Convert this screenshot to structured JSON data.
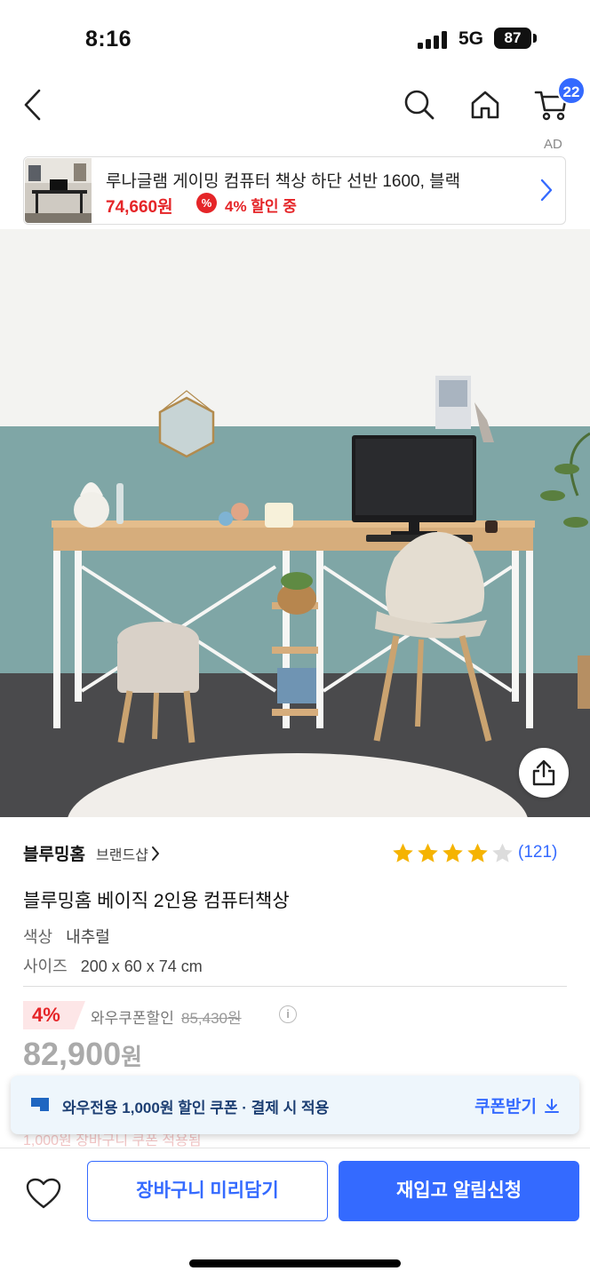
{
  "status_bar": {
    "time": "8:16",
    "network": "5G",
    "battery": "87"
  },
  "nav": {
    "cart_count": "22",
    "ad_label": "AD"
  },
  "ad": {
    "title": "루나글램 게이밍 컴퓨터 책상 하단 선반 1600, 블랙",
    "price": "74,660원",
    "coupon_icon": "%",
    "discount": "4% 할인 중"
  },
  "product": {
    "brand": "블루밍홈",
    "brand_shop": "브랜드샵",
    "rating": 4,
    "review_count": "(121)",
    "title": "블루밍홈 베이직 2인용 컴퓨터책상",
    "color_label": "색상",
    "color_value": "내추럴",
    "size_label": "사이즈",
    "size_value": "200 x 60 x 74 cm",
    "discount_rate": "4%",
    "coupon_discount_label": "와우쿠폰할인",
    "original_price": "85,430원",
    "price": "82,900",
    "price_unit": "원",
    "info_icon": "i"
  },
  "coupon_banner": {
    "text": "와우전용 1,000원 할인 쿠폰 · 결제 시 적용",
    "action": "쿠폰받기"
  },
  "peek_text": "1,000원   장바구니 쿠폰 적용됨",
  "bottom": {
    "cart_button": "장바구니 미리담기",
    "notify_button": "재입고 알림신청"
  },
  "icons": {
    "back": "back-icon",
    "search": "search-icon",
    "home": "home-icon",
    "cart": "cart-icon",
    "share": "share-icon",
    "heart": "heart-icon",
    "star": "star-icon",
    "download": "download-icon"
  },
  "colors": {
    "accent": "#346aff",
    "sale_red": "#e52528",
    "star_gold": "#f5b301",
    "banner_bg": "#eef6fc"
  }
}
